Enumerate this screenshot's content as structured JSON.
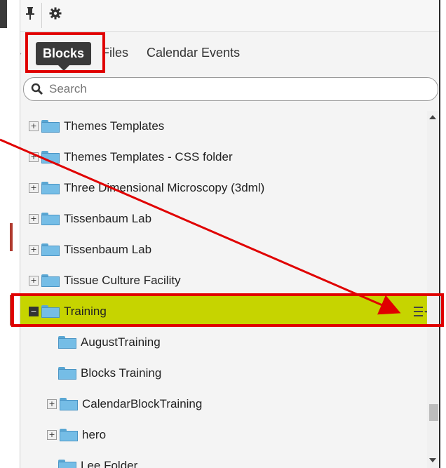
{
  "tabs": [
    {
      "label": "Blocks",
      "active": true
    },
    {
      "label": "Files",
      "active": false
    },
    {
      "label": "Calendar Events",
      "active": false
    }
  ],
  "search": {
    "placeholder": "Search"
  },
  "tree": [
    {
      "label": "Themes Templates",
      "expanded": false,
      "level": 0
    },
    {
      "label": "Themes Templates - CSS folder",
      "expanded": false,
      "level": 0
    },
    {
      "label": "Three Dimensional Microscopy (3dml)",
      "expanded": false,
      "level": 0
    },
    {
      "label": "Tissenbaum Lab",
      "expanded": false,
      "level": 0
    },
    {
      "label": "Tissenbaum Lab",
      "expanded": false,
      "level": 0
    },
    {
      "label": "Tissue Culture Facility",
      "expanded": false,
      "level": 0
    },
    {
      "label": "Training",
      "expanded": true,
      "level": 0,
      "selected": true
    },
    {
      "label": "AugustTraining",
      "level": 1
    },
    {
      "label": "Blocks Training",
      "level": 1
    },
    {
      "label": "CalendarBlockTraining",
      "expanded": false,
      "level": 1
    },
    {
      "label": "hero",
      "expanded": false,
      "level": 1
    },
    {
      "label": "Lee Folder",
      "level": 1
    }
  ],
  "colors": {
    "selected_row": "#c6d400",
    "annotation": "#e00000",
    "folder": "#75bde6"
  },
  "icons": {
    "pin": "pin-icon",
    "gear": "gear-icon",
    "search": "search-icon",
    "row_menu": "menu-icon"
  }
}
